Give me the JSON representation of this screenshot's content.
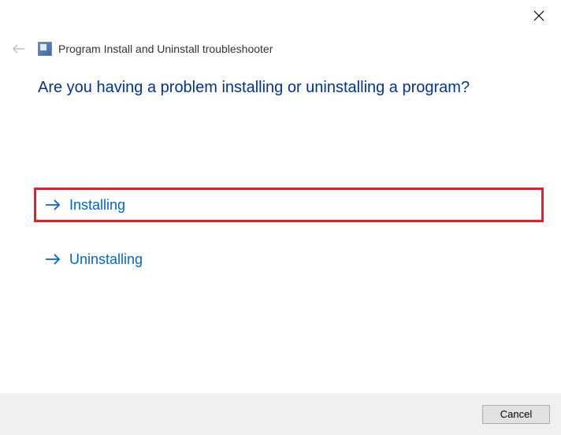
{
  "header": {
    "title": "Program Install and Uninstall troubleshooter"
  },
  "main": {
    "heading": "Are you having a problem installing or uninstalling a program?",
    "options": [
      {
        "label": "Installing",
        "highlighted": true
      },
      {
        "label": "Uninstalling",
        "highlighted": false
      }
    ]
  },
  "footer": {
    "cancel_label": "Cancel"
  },
  "colors": {
    "link": "#0066cc",
    "heading": "#003399",
    "highlight_border": "#ed1c24"
  }
}
